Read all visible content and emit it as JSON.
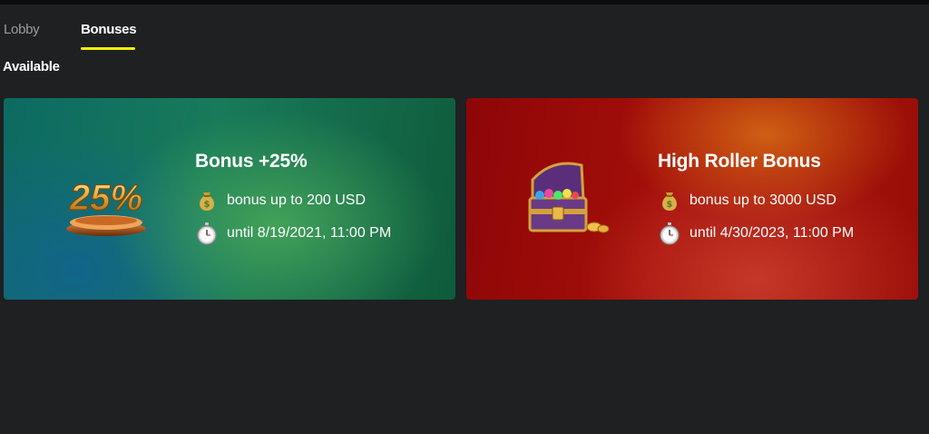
{
  "tabs": [
    {
      "label": "Lobby",
      "active": false
    },
    {
      "label": "Bonuses",
      "active": true
    }
  ],
  "section": {
    "title": "Available"
  },
  "bonuses": [
    {
      "title": "Bonus +25%",
      "amount_text": "bonus up to 200 USD",
      "until_text": "until 8/19/2021, 11:00 PM",
      "art_icon": "25-percent-trophy-icon",
      "art_text": "25%",
      "theme": "green"
    },
    {
      "title": "High Roller Bonus",
      "amount_text": "bonus up to 3000 USD",
      "until_text": "until 4/30/2023, 11:00 PM",
      "art_icon": "treasure-chest-icon",
      "theme": "red"
    }
  ],
  "icons": {
    "amount": "money-bag-icon",
    "date": "stopwatch-icon"
  },
  "colors": {
    "background": "#1e2022",
    "tab_accent": "#f3f007",
    "inactive_tab": "#9a9da1"
  }
}
